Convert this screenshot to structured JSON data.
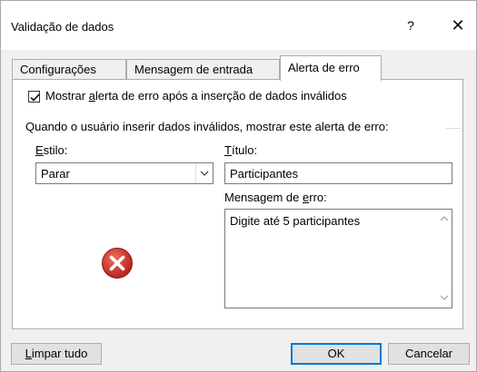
{
  "window": {
    "title": "Validação de dados",
    "help_glyph": "?",
    "close_glyph": "✕"
  },
  "tabs": [
    {
      "label": "Configurações",
      "active": false
    },
    {
      "label": "Mensagem de entrada",
      "active": false
    },
    {
      "label": "Alerta de erro",
      "active": true
    }
  ],
  "error_alert": {
    "show_checkbox": {
      "checked": true,
      "label_before": "Mostrar ",
      "label_mnemonic": "a",
      "label_after": "lerta de erro após a inserção de dados inválidos"
    },
    "group_label": "Quando o usuário inserir dados inválidos, mostrar este alerta de erro:",
    "style": {
      "label_mnemonic": "E",
      "label_rest": "stilo:",
      "value": "Parar"
    },
    "title": {
      "label_mnemonic": "T",
      "label_rest": "ítulo:",
      "value": "Participantes"
    },
    "message": {
      "label_before": "Mensagem de ",
      "label_mnemonic": "e",
      "label_after": "rro:",
      "value": "Digite até 5 participantes"
    },
    "icon": "error-stop-icon"
  },
  "footer": {
    "clear_all": {
      "mnemonic": "L",
      "rest": "impar tudo"
    },
    "ok_label": "OK",
    "cancel_label": "Cancelar"
  },
  "colors": {
    "error_red": "#d0342c",
    "focus_blue": "#0078d7"
  }
}
